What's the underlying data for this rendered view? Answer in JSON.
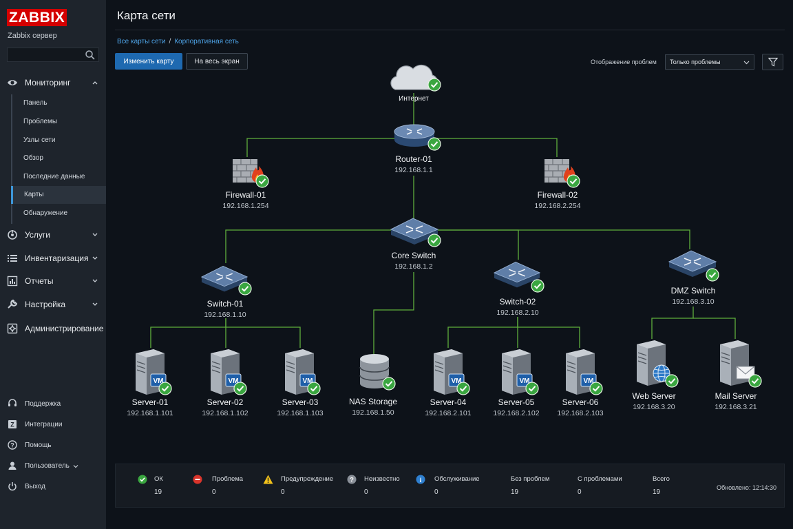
{
  "app": {
    "logo": "ZABBIX",
    "server_name": "Zabbix сервер"
  },
  "sidebar": {
    "sections": [
      {
        "label": "Мониторинг",
        "icon": "eye-icon"
      },
      {
        "label": "Услуги",
        "icon": "services-icon"
      },
      {
        "label": "Инвентаризация",
        "icon": "list-icon"
      },
      {
        "label": "Отчеты",
        "icon": "reports-icon"
      },
      {
        "label": "Настройка",
        "icon": "wrench-icon"
      },
      {
        "label": "Администрирование",
        "icon": "gear-icon"
      }
    ],
    "monitoring_items": [
      "Панель",
      "Проблемы",
      "Узлы сети",
      "Обзор",
      "Последние данные",
      "Карты",
      "Обнаружение"
    ],
    "active_item": "Карты",
    "footer": [
      "Поддержка",
      "Интеграции",
      "Помощь",
      "Пользователь",
      "Выход"
    ]
  },
  "header": {
    "title": "Карта сети",
    "breadcrumb": [
      "Все карты сети",
      "Корпоративная сеть"
    ],
    "edit_button": "Изменить карту",
    "fullscreen_button": "На весь экран",
    "problem_display_label": "Отображение проблем",
    "problem_display_value": "Только проблемы"
  },
  "map": {
    "nodes": {
      "internet": {
        "name": "Интернет",
        "ip": ""
      },
      "router": {
        "name": "Router-01",
        "ip": "192.168.1.1"
      },
      "fw1": {
        "name": "Firewall-01",
        "ip": "192.168.1.254"
      },
      "fw2": {
        "name": "Firewall-02",
        "ip": "192.168.2.254"
      },
      "core": {
        "name": "Core Switch",
        "ip": "192.168.1.2"
      },
      "sw1": {
        "name": "Switch-01",
        "ip": "192.168.1.10"
      },
      "sw2": {
        "name": "Switch-02",
        "ip": "192.168.2.10"
      },
      "dmz": {
        "name": "DMZ Switch",
        "ip": "192.168.3.10"
      },
      "s1": {
        "name": "Server-01",
        "ip": "192.168.1.101"
      },
      "s2": {
        "name": "Server-02",
        "ip": "192.168.1.102"
      },
      "s3": {
        "name": "Server-03",
        "ip": "192.168.1.103"
      },
      "nas": {
        "name": "NAS Storage",
        "ip": "192.168.1.50"
      },
      "s4": {
        "name": "Server-04",
        "ip": "192.168.2.101"
      },
      "s5": {
        "name": "Server-05",
        "ip": "192.168.2.102"
      },
      "s6": {
        "name": "Server-06",
        "ip": "192.168.2.103"
      },
      "web": {
        "name": "Web Server",
        "ip": "192.168.3.20"
      },
      "mail": {
        "name": "Mail Server",
        "ip": "192.168.3.21"
      }
    },
    "vm_badge": "VM",
    "link_color": "#5fae3c",
    "ok_color": "#3aa640"
  },
  "legend": {
    "ok": {
      "label": "ОК",
      "value": "19"
    },
    "problem": {
      "label": "Проблема",
      "value": "0"
    },
    "warning": {
      "label": "Предупреждение",
      "value": "0"
    },
    "unknown": {
      "label": "Неизвестно",
      "value": "0"
    },
    "maintenance": {
      "label": "Обслуживание",
      "value": "0"
    },
    "no_problems": {
      "label": "Без проблем",
      "value": "19"
    },
    "with_problems": {
      "label": "С проблемами",
      "value": "0"
    },
    "total": {
      "label": "Всего",
      "value": "19"
    },
    "updated": "Обновлено: 12:14:30"
  }
}
